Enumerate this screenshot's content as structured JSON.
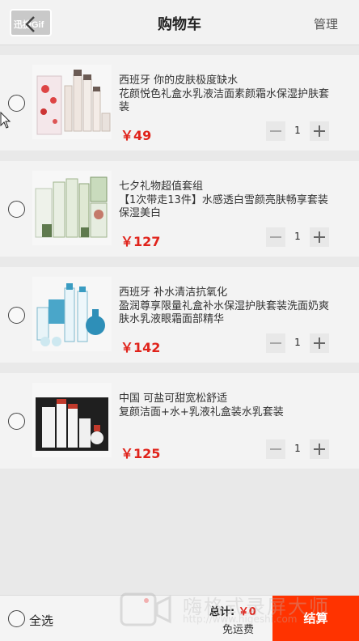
{
  "header": {
    "title": "购物车",
    "manage_label": "管理",
    "watermark_small": "迅捷Gif"
  },
  "items": [
    {
      "shop": "西班牙 你的皮肤极度缺水",
      "description": "花颜悦色礼盒水乳液洁面素颜霜水保湿护肤套装",
      "price": "￥49",
      "quantity": "1"
    },
    {
      "shop": "七夕礼物超值套组",
      "description": "【1次带走13件】水感透白雪颜亮肤畅享套装保湿美白",
      "price": "￥127",
      "quantity": "1"
    },
    {
      "shop": "西班牙 补水清洁抗氧化",
      "description": "盈润尊享限量礼盒补水保湿护肤套装洗面奶爽肤水乳液眼霜面部精华",
      "price": "￥142",
      "quantity": "1"
    },
    {
      "shop": "中国 可盐可甜宽松舒适",
      "description": "复颜洁面+水+乳液礼盒装水乳套装",
      "price": "￥125",
      "quantity": "1"
    }
  ],
  "footer": {
    "select_all_label": "全选",
    "total_label": "总计:",
    "total_value": "￥0",
    "shipping_label": "免运费",
    "checkout_label": "结算"
  },
  "watermark": {
    "text": "嗨格式录屏大师",
    "url": "http://www.higeshi.com"
  },
  "colors": {
    "accent": "#e0231b",
    "checkout_bg": "#ff3300"
  }
}
